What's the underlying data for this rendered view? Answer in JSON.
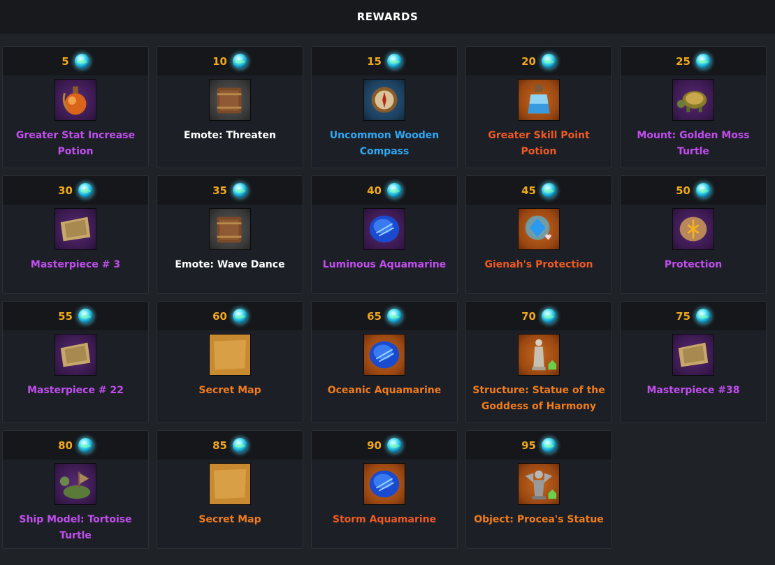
{
  "header": {
    "title": "REWARDS"
  },
  "colors": {
    "tier_text": "#f0a81c",
    "purple": "#c24ef0",
    "white": "#ffffff",
    "blue": "#2ea8f5",
    "orange": "#f17c1c",
    "red_orange": "#f05a22"
  },
  "rewards": [
    {
      "tier": "5",
      "name": "Greater Stat Increase Potion",
      "icon": "potion-round-icon"
    },
    {
      "tier": "10",
      "name": "Emote: Threaten",
      "icon": "book-icon"
    },
    {
      "tier": "15",
      "name": "Uncommon Wooden Compass",
      "icon": "compass-icon"
    },
    {
      "tier": "20",
      "name": "Greater Skill Point Potion",
      "icon": "potion-bottle-icon"
    },
    {
      "tier": "25",
      "name": "Mount: Golden Moss Turtle",
      "icon": "turtle-icon"
    },
    {
      "tier": "30",
      "name": "Masterpiece # 3",
      "icon": "painting-icon"
    },
    {
      "tier": "35",
      "name": "Emote: Wave Dance",
      "icon": "book-icon"
    },
    {
      "tier": "40",
      "name": "Luminous Aquamarine",
      "icon": "aquamarine-icon"
    },
    {
      "tier": "45",
      "name": "Gienah's Protection",
      "icon": "gem-heart-icon"
    },
    {
      "tier": "50",
      "name": "Protection",
      "icon": "rune-stone-icon"
    },
    {
      "tier": "55",
      "name": "Masterpiece # 22",
      "icon": "painting-icon"
    },
    {
      "tier": "60",
      "name": "Secret Map",
      "icon": "map-icon"
    },
    {
      "tier": "65",
      "name": "Oceanic Aquamarine",
      "icon": "aquamarine-icon"
    },
    {
      "tier": "70",
      "name": "Structure: Statue of the Goddess of Harmony",
      "icon": "statue-icon"
    },
    {
      "tier": "75",
      "name": "Masterpiece #38",
      "icon": "painting-icon"
    },
    {
      "tier": "80",
      "name": "Ship Model: Tortoise Turtle",
      "icon": "ship-turtle-icon"
    },
    {
      "tier": "85",
      "name": "Secret Map",
      "icon": "map-icon"
    },
    {
      "tier": "90",
      "name": "Storm Aquamarine",
      "icon": "aquamarine-icon"
    },
    {
      "tier": "95",
      "name": "Object: Procea's Statue",
      "icon": "gargoyle-statue-icon"
    }
  ]
}
